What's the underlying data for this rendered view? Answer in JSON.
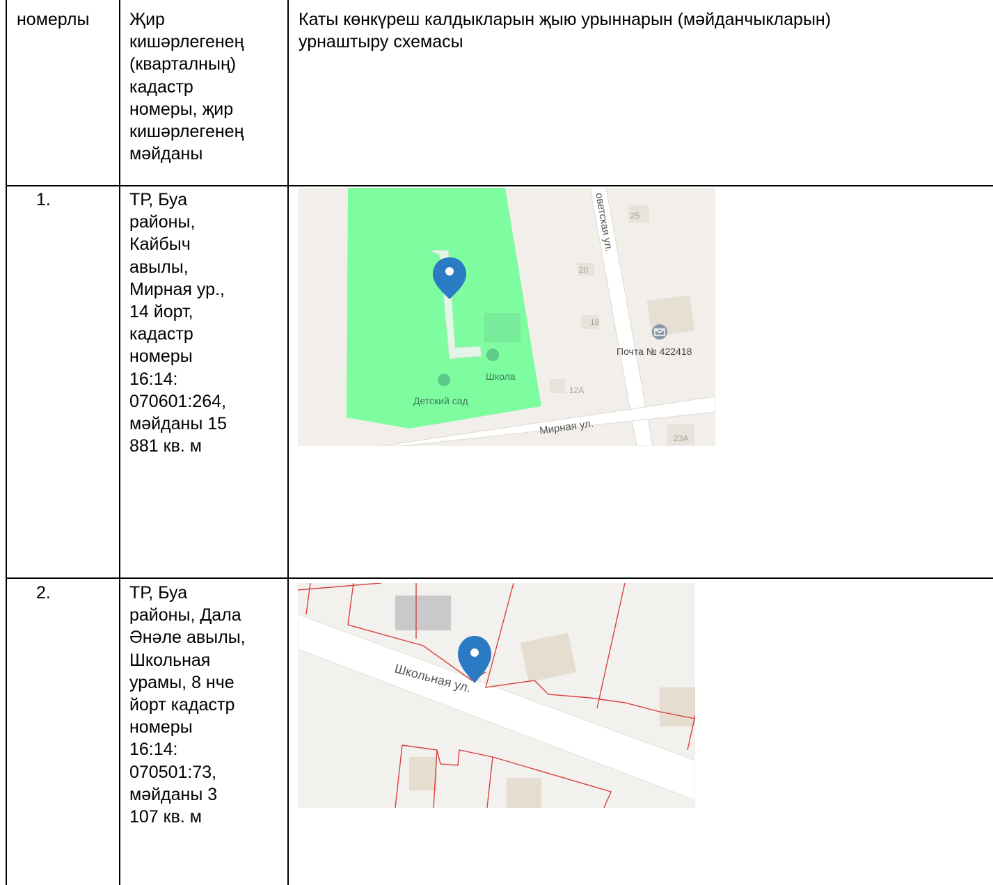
{
  "table": {
    "headers": {
      "number": "номерлы",
      "cadastral": "Җир\nкишәрлегенең\n(кварталның)\nкадастр\nномеры, җир\nкишәрлегенең\nмәйданы",
      "scheme": "Каты көнкүреш калдыкларын җыю урыннарын (мәйданчыкларын)\nурнаштыру схемасы"
    },
    "rows": [
      {
        "number": "1.",
        "location": "ТР, Буа\nрайоны,\nКайбыч\nавылы,\nМирная ур.,\n14 йорт,\nкадастр\nномеры\n16:14:\n070601:264,\nмәйданы 15\n881 кв. м",
        "map": {
          "street_1": "оветская ул.",
          "street_2": "Мирная ул.",
          "house_25": "25",
          "house_20": "20",
          "house_18": "18",
          "house_12a": "12А",
          "house_23a": "23А",
          "poi_school": "Школа",
          "poi_kindergarten": "Детский сад",
          "poi_post": "Почта № 422418",
          "school_area_color": "#7efca0"
        }
      },
      {
        "number": "2.",
        "location": "ТР, Буа\nрайоны, Дала\nӘнәле авылы,\nШкольная\nурамы, 8 нче\nйорт кадастр\nномеры\n16:14:\n070501:73,\nмәйданы 3\n107 кв. м",
        "map": {
          "street": "Школьная ул.",
          "parcel_line_color": "#d9403f"
        }
      }
    ]
  },
  "colors": {
    "marker": "#2a7bc4",
    "map_bg": "#f2efea"
  }
}
